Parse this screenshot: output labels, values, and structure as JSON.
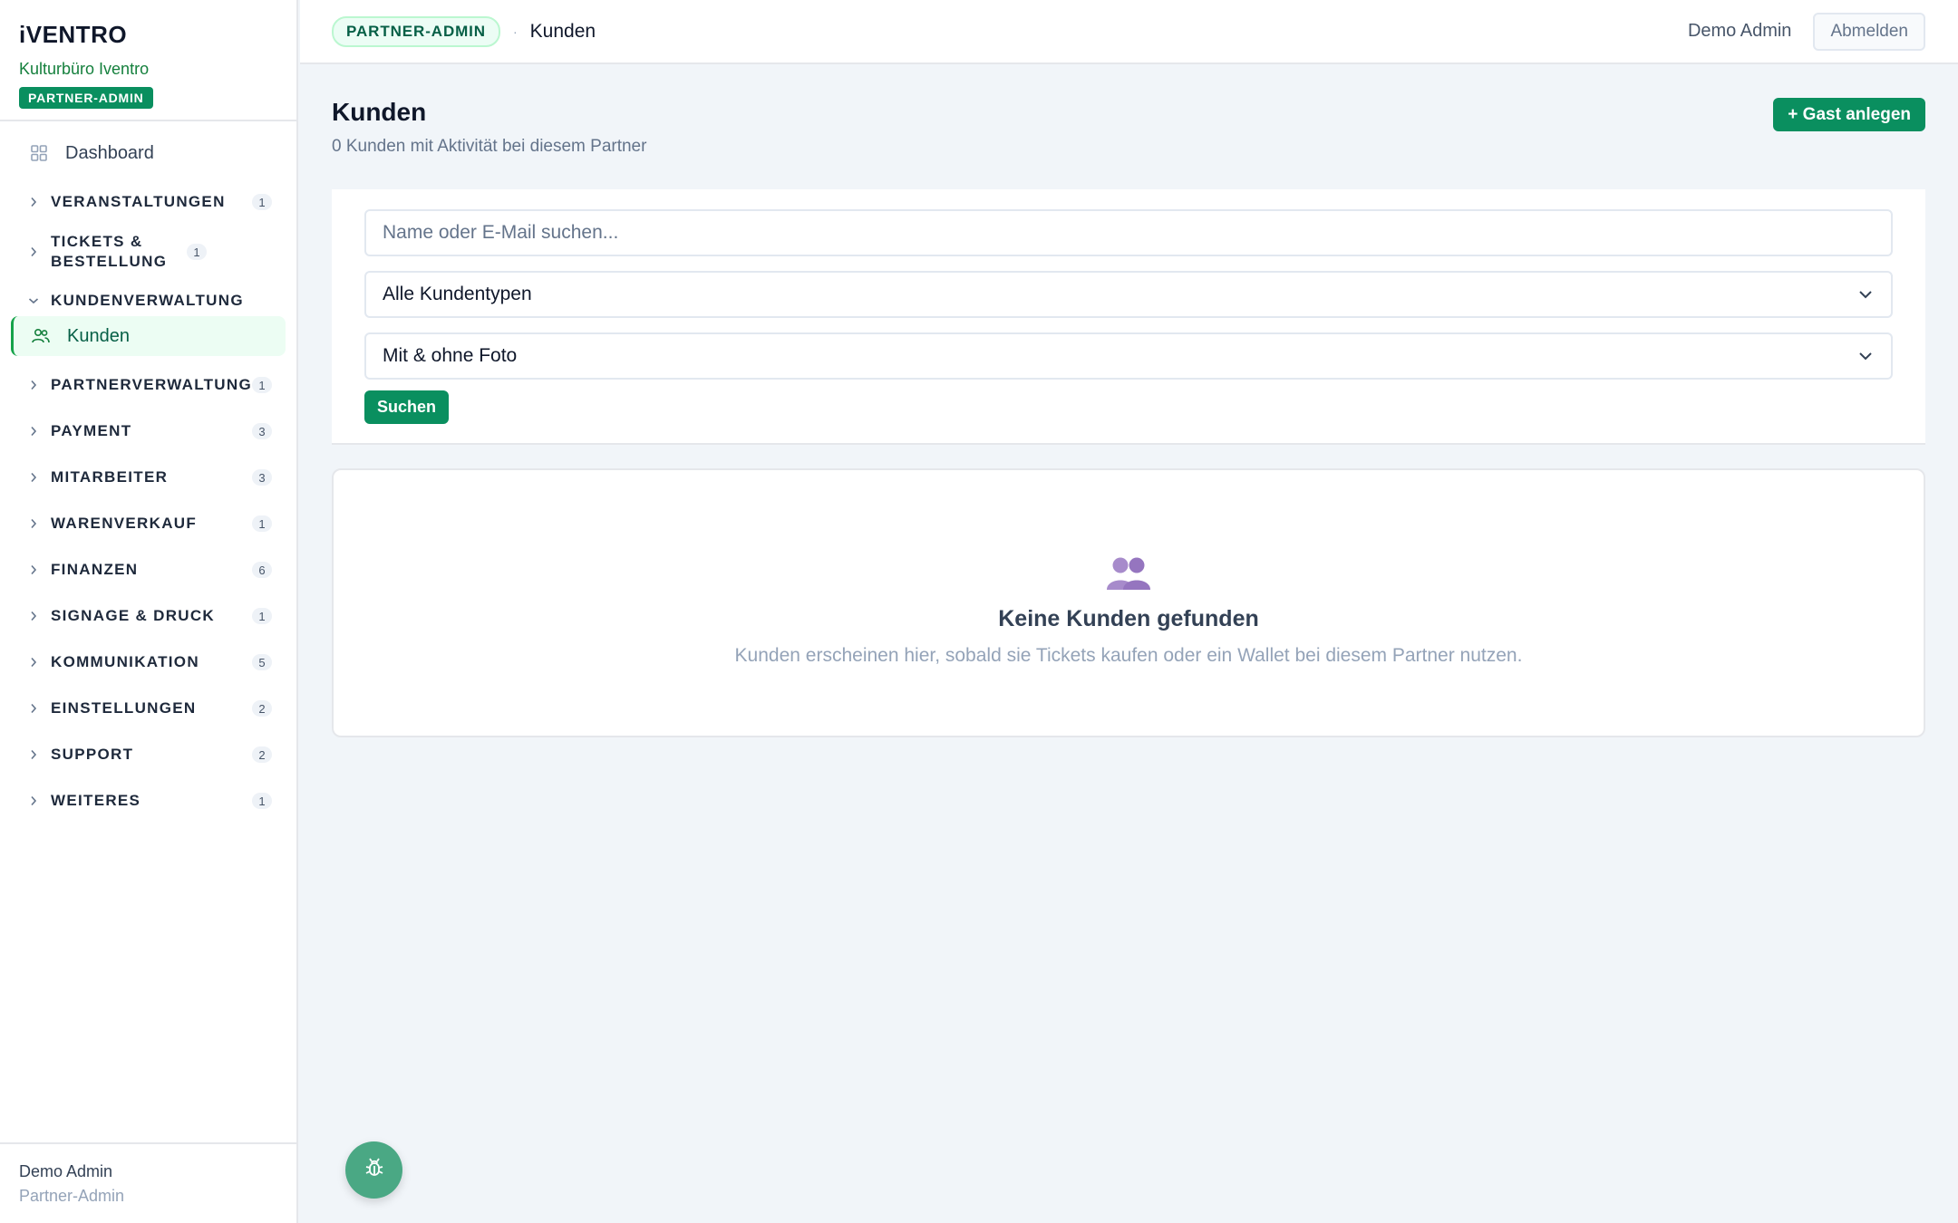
{
  "brand": {
    "logo": "iVENTRO",
    "org": "Kulturbüro Iventro",
    "role_badge": "PARTNER-ADMIN"
  },
  "sidebar": {
    "dashboard_label": "Dashboard",
    "sections": [
      {
        "label": "VERANSTALTUNGEN",
        "count": "1",
        "expanded": false
      },
      {
        "label": "TICKETS & BESTELLUNG",
        "count": "1",
        "expanded": false
      },
      {
        "label": "KUNDENVERWALTUNG",
        "count": "",
        "expanded": true
      },
      {
        "label": "PARTNERVERWALTUNG",
        "count": "1",
        "expanded": false
      },
      {
        "label": "PAYMENT",
        "count": "3",
        "expanded": false
      },
      {
        "label": "MITARBEITER",
        "count": "3",
        "expanded": false
      },
      {
        "label": "WARENVERKAUF",
        "count": "1",
        "expanded": false
      },
      {
        "label": "FINANZEN",
        "count": "6",
        "expanded": false
      },
      {
        "label": "SIGNAGE & DRUCK",
        "count": "1",
        "expanded": false
      },
      {
        "label": "KOMMUNIKATION",
        "count": "5",
        "expanded": false
      },
      {
        "label": "EINSTELLUNGEN",
        "count": "2",
        "expanded": false
      },
      {
        "label": "SUPPORT",
        "count": "2",
        "expanded": false
      },
      {
        "label": "WEITERES",
        "count": "1",
        "expanded": false
      }
    ],
    "active_item": "Kunden",
    "footer": {
      "name": "Demo Admin",
      "role": "Partner-Admin"
    }
  },
  "topbar": {
    "role_pill": "PARTNER-ADMIN",
    "separator": "·",
    "breadcrumb": "Kunden",
    "user": "Demo Admin",
    "logout_label": "Abmelden"
  },
  "page": {
    "title": "Kunden",
    "subtitle": "0 Kunden mit Aktivität bei diesem Partner",
    "add_button": "+ Gast anlegen"
  },
  "filters": {
    "search_placeholder": "Name oder E-Mail suchen...",
    "type_select": "Alle Kundentypen",
    "photo_select": "Mit & ohne Foto",
    "search_button": "Suchen"
  },
  "empty": {
    "title": "Keine Kunden gefunden",
    "text": "Kunden erscheinen hier, sobald sie Tickets kaufen oder ein Wallet bei diesem Partner nutzen."
  },
  "icons": {
    "dashboard": "grid-icon",
    "kunden": "users-icon",
    "empty": "people-icon",
    "fab": "bug-icon"
  },
  "colors": {
    "primary": "#0a8f5f",
    "active_bg": "#ecfdf3",
    "empty_icon": "#a78bcb",
    "fab": "#4aa884"
  }
}
